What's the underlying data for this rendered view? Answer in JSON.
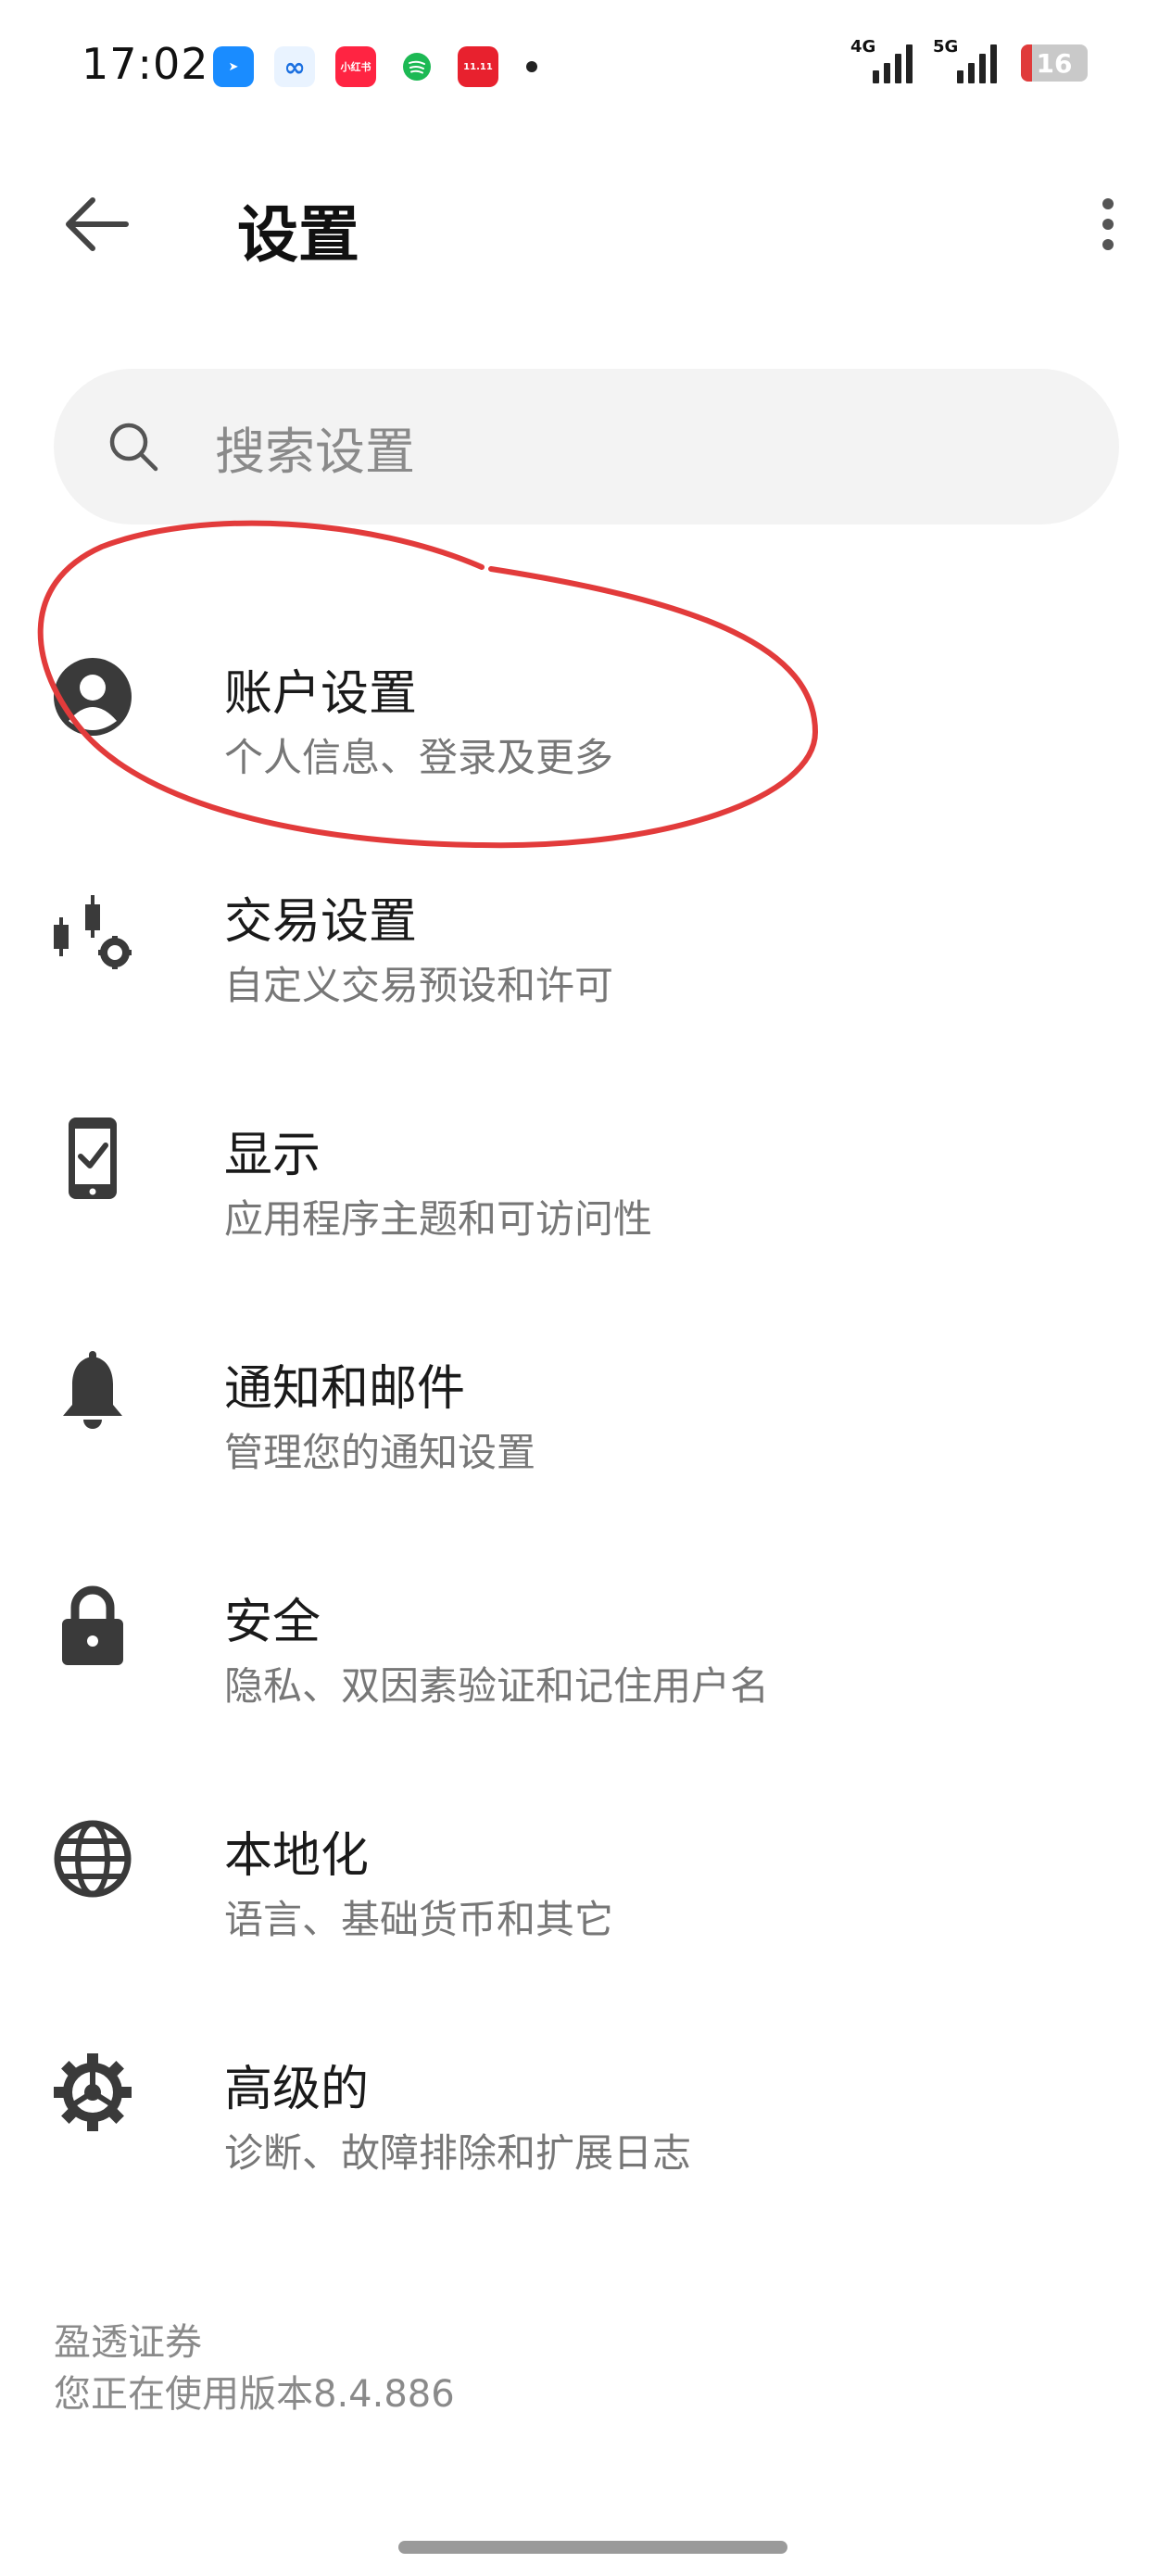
{
  "status_bar": {
    "time": "17:02",
    "app_icons": [
      {
        "name": "blue-arrow-app-icon",
        "color": "#1a8cff",
        "glyph": "➤"
      },
      {
        "name": "blue-infinity-app-icon",
        "color": "#e9f3ff",
        "glyph": "∞"
      },
      {
        "name": "xiaohongshu-app-icon",
        "color": "#ff2442",
        "glyph": "小红书"
      },
      {
        "name": "green-music-app-icon",
        "color": "#1db954",
        "glyph": "≡"
      },
      {
        "name": "red-shopping-app-icon",
        "color": "#e8212e",
        "glyph": "11.11"
      }
    ],
    "signal_1_label": "4G",
    "signal_2_label": "5G",
    "battery_level": "16"
  },
  "header": {
    "title": "设置"
  },
  "search": {
    "placeholder": "搜索设置"
  },
  "items": [
    {
      "icon": "account-circle-icon",
      "title": "账户设置",
      "subtitle": "个人信息、登录及更多"
    },
    {
      "icon": "trading-settings-icon",
      "title": "交易设置",
      "subtitle": "自定义交易预设和许可"
    },
    {
      "icon": "phone-check-icon",
      "title": "显示",
      "subtitle": "应用程序主题和可访问性"
    },
    {
      "icon": "bell-icon",
      "title": "通知和邮件",
      "subtitle": "管理您的通知设置"
    },
    {
      "icon": "lock-icon",
      "title": "安全",
      "subtitle": "隐私、双因素验证和记住用户名"
    },
    {
      "icon": "globe-icon",
      "title": "本地化",
      "subtitle": "语言、基础货币和其它"
    },
    {
      "icon": "gear-icon",
      "title": "高级的",
      "subtitle": "诊断、故障排除和扩展日志"
    }
  ],
  "footer": {
    "company": "盈透证券",
    "version": "您正在使用版本8.4.886"
  },
  "colors": {
    "annotation": "#e23b3b",
    "icon": "#3a3a3a"
  }
}
